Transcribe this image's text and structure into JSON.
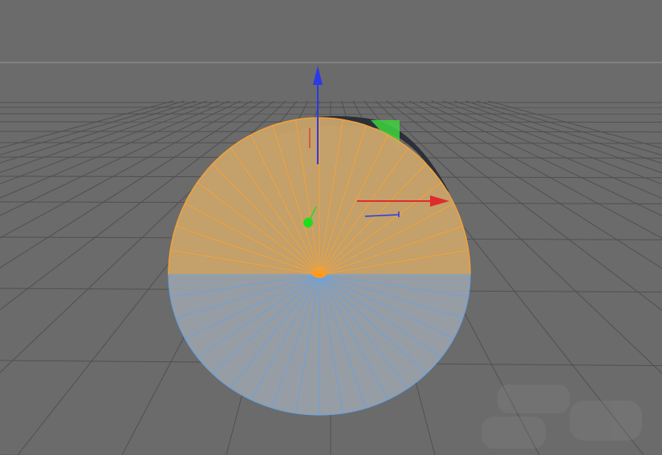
{
  "viewport": {
    "type": "3d-perspective-viewport",
    "background_color": "#6b6b6b",
    "grid_color": "#505050",
    "horizon_color": "#9a9a9a"
  },
  "object": {
    "name": "",
    "kind": "disc-mesh",
    "segments_visible": 40,
    "selected_half_color": "#f2a33a",
    "selected_half_fill": "#c9a36a",
    "unselected_half_color": "#6aa2e0",
    "unselected_half_fill": "#9aa0a8",
    "rim_color": "#2b2f38"
  },
  "gizmo": {
    "axes": [
      {
        "axis": "z",
        "color": "#2a3ae6"
      },
      {
        "axis": "x",
        "color": "#e02b2b"
      },
      {
        "axis": "y",
        "color": "#1fdc1f"
      }
    ],
    "pivot_color": "#ff9a1f"
  },
  "icons": {
    "move-gizmo": "axis-arrows",
    "pivot": "dot"
  }
}
